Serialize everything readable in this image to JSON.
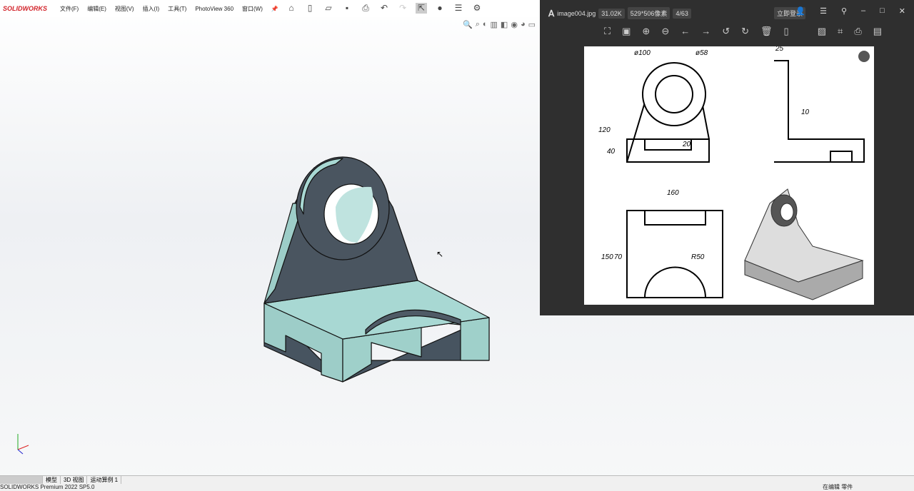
{
  "app": {
    "brand": "SOLIDWORKS",
    "menu": [
      "文件(F)",
      "编辑(E)",
      "视图(V)",
      "插入(I)",
      "工具(T)",
      "PhotoView 360",
      "窗口(W)"
    ]
  },
  "tabs": [
    "模型",
    "3D 视图",
    "运动算例 1"
  ],
  "status": {
    "left": "SOLIDWORKS Premium 2022 SP5.0",
    "right": "在编辑 零件"
  },
  "viewer": {
    "filename": "image004.jpg",
    "size": "31.02K",
    "dims": "529*506像素",
    "index": "4/63",
    "login": "立即登录"
  },
  "drawing": {
    "d1": "ø100",
    "d2": "ø58",
    "w_side": "25",
    "t_side": "10",
    "h_total": "120",
    "h_base": "40",
    "slot": "20",
    "width": "160",
    "depth": "150",
    "d70": "70",
    "radius": "R50"
  },
  "colors": {
    "part": "#a6d4cf",
    "part_dark": "#4a5560",
    "viewer_bg": "#2f2f2f"
  }
}
